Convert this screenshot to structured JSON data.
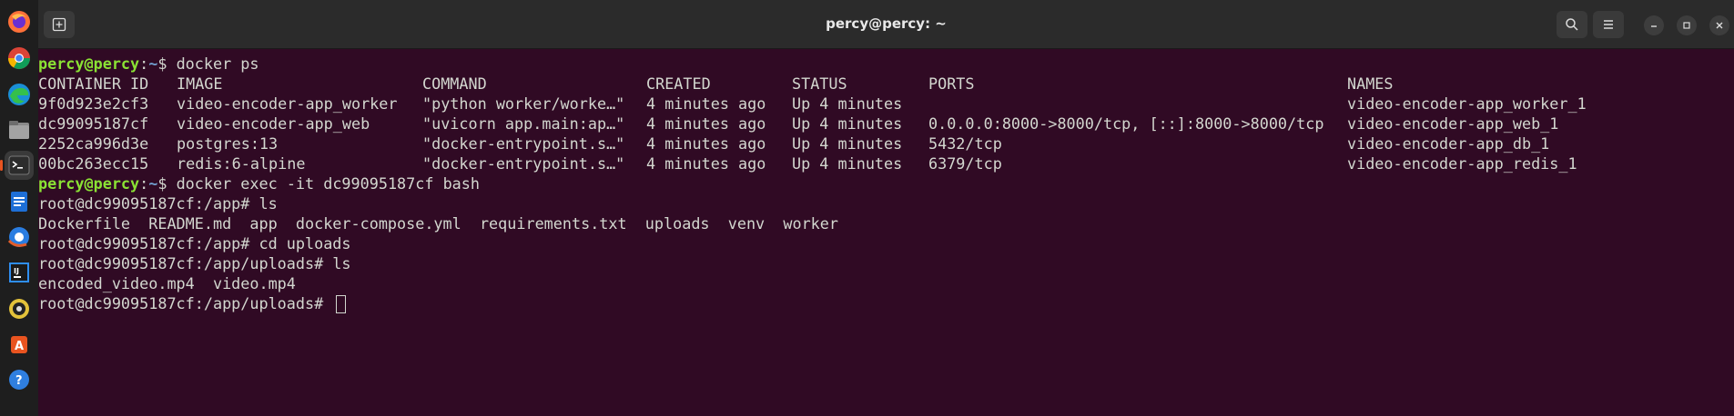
{
  "window": {
    "title": "percy@percy: ~"
  },
  "dock": {
    "items": [
      {
        "name": "firefox-icon"
      },
      {
        "name": "chrome-icon"
      },
      {
        "name": "edge-icon"
      },
      {
        "name": "files-icon"
      },
      {
        "name": "terminal-icon"
      },
      {
        "name": "libreoffice-writer-icon"
      },
      {
        "name": "browser-icon"
      },
      {
        "name": "jetbrains-icon"
      },
      {
        "name": "rhythmbox-icon"
      },
      {
        "name": "software-center-icon"
      },
      {
        "name": "help-icon"
      }
    ]
  },
  "terminal": {
    "prompt1": {
      "user": "percy@percy",
      "sep": ":",
      "path": "~",
      "symbol": "$ ",
      "command": "docker ps"
    },
    "table": {
      "headers": [
        "CONTAINER ID",
        "IMAGE",
        "COMMAND",
        "CREATED",
        "STATUS",
        "PORTS",
        "NAMES"
      ],
      "rows": [
        [
          "9f0d923e2cf3",
          "video-encoder-app_worker",
          "\"python worker/worke…\"",
          "4 minutes ago",
          "Up 4 minutes",
          "",
          "video-encoder-app_worker_1"
        ],
        [
          "dc99095187cf",
          "video-encoder-app_web",
          "\"uvicorn app.main:ap…\"",
          "4 minutes ago",
          "Up 4 minutes",
          "0.0.0.0:8000->8000/tcp, [::]:8000->8000/tcp",
          "video-encoder-app_web_1"
        ],
        [
          "2252ca996d3e",
          "postgres:13",
          "\"docker-entrypoint.s…\"",
          "4 minutes ago",
          "Up 4 minutes",
          "5432/tcp",
          "video-encoder-app_db_1"
        ],
        [
          "00bc263ecc15",
          "redis:6-alpine",
          "\"docker-entrypoint.s…\"",
          "4 minutes ago",
          "Up 4 minutes",
          "6379/tcp",
          "video-encoder-app_redis_1"
        ]
      ]
    },
    "prompt2": {
      "user": "percy@percy",
      "sep": ":",
      "path": "~",
      "symbol": "$ ",
      "command": "docker exec -it dc99095187cf bash"
    },
    "lines": [
      "root@dc99095187cf:/app# ls",
      "Dockerfile  README.md  app  docker-compose.yml  requirements.txt  uploads  venv  worker",
      "root@dc99095187cf:/app# cd uploads",
      "root@dc99095187cf:/app/uploads# ls",
      "encoded_video.mp4  video.mp4",
      "root@dc99095187cf:/app/uploads# "
    ]
  },
  "colors": {
    "background": "#300a24",
    "prompt_user": "#8ae234",
    "prompt_path": "#729fcf",
    "text": "#d3d7cf"
  }
}
